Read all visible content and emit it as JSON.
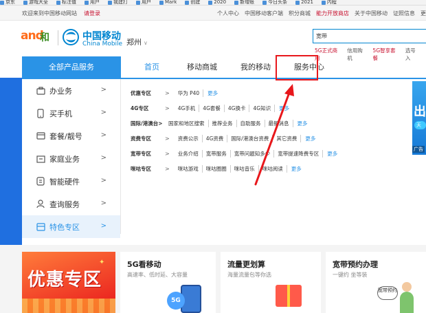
{
  "bookmarks": [
    "京东",
    "游戏大全",
    "标注值",
    "用户",
    "我建打",
    "用户",
    "Mark",
    "创建",
    "2020",
    "新增账",
    "今日头条",
    "2021",
    "内程"
  ],
  "topbar": {
    "welcome": "欢迎来到中国移动网站",
    "login": "请登录",
    "links": [
      "个人中心",
      "中国移动客户端",
      "积分商城",
      "能力开放商店",
      "关于中国移动",
      "证照信息",
      "更"
    ]
  },
  "header": {
    "logo_and": "and",
    "logo_he": "和",
    "brand_zh": "中国移动",
    "brand_en": "China Mobile",
    "city": "郑州",
    "search_value": "宽带",
    "hotwords": [
      "5G正式商用",
      "信用购机",
      "5G智享套餐",
      "选号入"
    ]
  },
  "nav": {
    "all_products": "全部产品服务",
    "tabs": [
      "首页",
      "移动商城",
      "我的移动",
      "服务中心"
    ]
  },
  "sidebar": {
    "items": [
      {
        "label": "办业务",
        "icon": "briefcase-icon"
      },
      {
        "label": "买手机",
        "icon": "phone-icon"
      },
      {
        "label": "套餐/靓号",
        "icon": "wallet-icon"
      },
      {
        "label": "家庭业务",
        "icon": "home-icon"
      },
      {
        "label": "智能硬件",
        "icon": "device-icon"
      },
      {
        "label": "查询服务",
        "icon": "user-icon"
      },
      {
        "label": "特色专区",
        "icon": "star-icon"
      }
    ]
  },
  "submenu": [
    {
      "cat": "优惠专区",
      "items": [
        "华为 P40"
      ],
      "more": "更多"
    },
    {
      "cat": "4G专区",
      "items": [
        "4G手机",
        "4G套餐",
        "4G换卡",
        "4G知识"
      ],
      "more": "更多"
    },
    {
      "cat": "国际/港澳台>",
      "items": [
        "国家和地区搜索",
        "推荐业务",
        "自助服务",
        "最新消息"
      ],
      "more": "更多"
    },
    {
      "cat": "资费专区",
      "items": [
        "资费公示",
        "4G资费",
        "国际/港澳台资费",
        "其它资费"
      ],
      "more": "更多"
    },
    {
      "cat": "宽带专区",
      "items": [
        "业务介绍",
        "宽带服务",
        "宽带问题知多少",
        "宽带提速降费专区"
      ],
      "more": "更多"
    },
    {
      "cat": "咪咕专区",
      "items": [
        "咪咕游戏",
        "咪咕圈圈",
        "咪咕音乐",
        "咪咕阅读"
      ],
      "more": "更多"
    }
  ],
  "right_promo": {
    "big": "出",
    "pill": "天",
    "ad": "广告"
  },
  "bottom": {
    "promo_title": "优惠专区",
    "cards": [
      {
        "title": "5G看移动",
        "sub": "高速率、低时延、大容量",
        "badge": "5G"
      },
      {
        "title": "流量更划算",
        "sub": "海量流量包等你选"
      },
      {
        "title": "宽带预约办理",
        "sub": "一键约 坐等装",
        "bubble": "宽带预约"
      }
    ]
  },
  "colors": {
    "brand_blue": "#2a93e6",
    "highlight_red": "#e8171b",
    "cm_blue": "#0085d0"
  }
}
